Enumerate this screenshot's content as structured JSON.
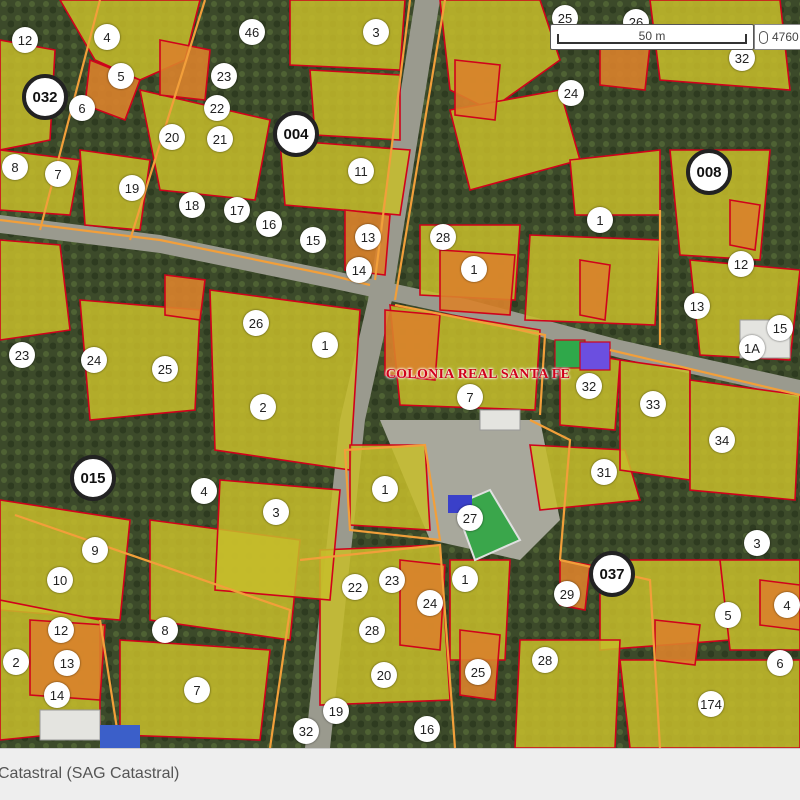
{
  "map": {
    "zone_label": "COLONIA REAL SANTA FE",
    "scale_label": "50 m",
    "coordinate_readout": "4760",
    "zones": [
      "032",
      "004",
      "008",
      "015",
      "037"
    ],
    "parcel_numbers": [
      "12",
      "4",
      "46",
      "3",
      "25",
      "26",
      "32",
      "5",
      "23",
      "22",
      "6",
      "24",
      "20",
      "21",
      "8",
      "7",
      "19",
      "18",
      "17",
      "16",
      "15",
      "13",
      "11",
      "28",
      "1",
      "14",
      "12",
      "13",
      "15",
      "1A",
      "26",
      "1",
      "23",
      "24",
      "25",
      "2",
      "34",
      "31",
      "33",
      "32",
      "7",
      "27",
      "1",
      "4",
      "3",
      "9",
      "10",
      "12",
      "13",
      "14",
      "8",
      "7",
      "22",
      "23",
      "24",
      "28",
      "20",
      "19",
      "16",
      "32",
      "1",
      "25",
      "28",
      "29",
      "5",
      "4",
      "6",
      "174",
      "3",
      "2",
      "1"
    ]
  },
  "footer": {
    "layer_text": "Catastral (SAG Catastral)"
  },
  "colors": {
    "parcel_yellow": "#c7bd2a",
    "parcel_orange": "#d9822b",
    "parcel_border_red": "#d0021b",
    "block_border_orange": "#f29f3a",
    "zone_label_red": "#d0021b"
  }
}
